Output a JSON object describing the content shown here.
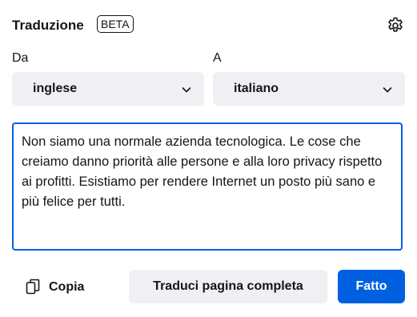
{
  "header": {
    "title": "Traduzione",
    "badge": "BETA",
    "settings_icon": "gear-icon"
  },
  "from": {
    "label": "Da",
    "value": "inglese",
    "icon": "chevron-down-icon"
  },
  "to": {
    "label": "A",
    "value": "italiano",
    "icon": "chevron-down-icon"
  },
  "source_text": "Non siamo una normale azienda tecnologica. Le cose che creiamo danno priorità alle persone e alla loro privacy rispetto ai profitti. Esistiamo per rendere Internet un posto più sano e più felice per tutti.",
  "actions": {
    "copy_label": "Copia",
    "copy_icon": "copy-icon",
    "translate_page_label": "Traduci pagina completa",
    "done_label": "Fatto"
  },
  "colors": {
    "accent": "#0061e0",
    "button_bg": "#f0f0f4",
    "text": "#15141a"
  }
}
